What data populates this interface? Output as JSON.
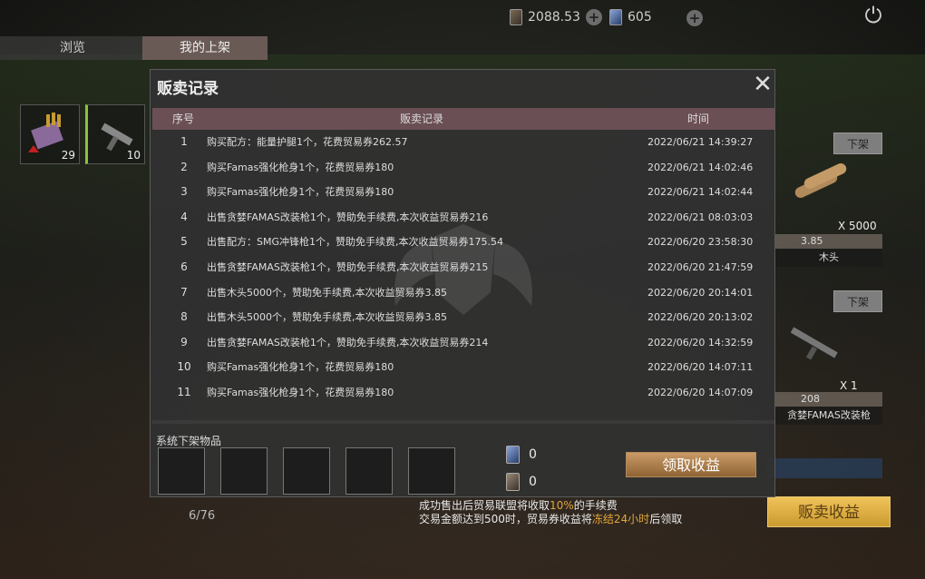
{
  "topbar": {
    "currency1": "2088.53",
    "currency2": "605",
    "currency1_icon": "trade-voucher-icon",
    "currency2_icon": "blue-card-icon",
    "power_icon": "power-icon"
  },
  "tabs": {
    "browse": "浏览",
    "mine": "我的上架"
  },
  "left_items": [
    {
      "count": "29"
    },
    {
      "count": "10"
    }
  ],
  "right_listings": [
    {
      "button": "下架",
      "qty": "X 5000",
      "price": "3.85",
      "name": "木头"
    },
    {
      "button": "下架",
      "qty": "X 1",
      "price": "208",
      "name": "贪婪FAMAS改装枪"
    }
  ],
  "bottom": {
    "page_count": "6/76",
    "notice_line1_pre": "成功售出后贸易联盟将收取",
    "notice_line1_hl": "10%",
    "notice_line1_post": "的手续费",
    "notice_line2_pre": "交易金额达到500时，贸易券收益将",
    "notice_line2_hl": "冻结24小时",
    "notice_line2_post": "后领取",
    "sell_income_button": "贩卖收益"
  },
  "dialog": {
    "title": "贩卖记录",
    "close_icon": "close-icon",
    "headers": {
      "index": "序号",
      "record": "贩卖记录",
      "time": "时间"
    },
    "rows": [
      {
        "index": "1",
        "record": "购买配方：能量护腿1个，花费贸易券262.57",
        "time": "2022/06/21 14:39:27"
      },
      {
        "index": "2",
        "record": "购买Famas强化枪身1个，花费贸易券180",
        "time": "2022/06/21 14:02:46"
      },
      {
        "index": "3",
        "record": "购买Famas强化枪身1个，花费贸易券180",
        "time": "2022/06/21 14:02:44"
      },
      {
        "index": "4",
        "record": "出售贪婪FAMAS改装枪1个，赞助免手续费,本次收益贸易券216",
        "time": "2022/06/21 08:03:03"
      },
      {
        "index": "5",
        "record": "出售配方：SMG冲锋枪1个，赞助免手续费,本次收益贸易券175.54",
        "time": "2022/06/20 23:58:30"
      },
      {
        "index": "6",
        "record": "出售贪婪FAMAS改装枪1个，赞助免手续费,本次收益贸易券215",
        "time": "2022/06/20 21:47:59"
      },
      {
        "index": "7",
        "record": "出售木头5000个，赞助免手续费,本次收益贸易券3.85",
        "time": "2022/06/20 20:14:01"
      },
      {
        "index": "8",
        "record": "出售木头5000个，赞助免手续费,本次收益贸易券3.85",
        "time": "2022/06/20 20:13:02"
      },
      {
        "index": "9",
        "record": "出售贪婪FAMAS改装枪1个，赞助免手续费,本次收益贸易券214",
        "time": "2022/06/20 14:32:59"
      },
      {
        "index": "10",
        "record": "购买Famas强化枪身1个，花费贸易券180",
        "time": "2022/06/20 14:07:11"
      },
      {
        "index": "11",
        "record": "购买Famas强化枪身1个，花费贸易券180",
        "time": "2022/06/20 14:07:09"
      }
    ],
    "system_removed_label": "系统下架物品",
    "balance1": "0",
    "balance2": "0",
    "collect_button": "领取收益"
  }
}
